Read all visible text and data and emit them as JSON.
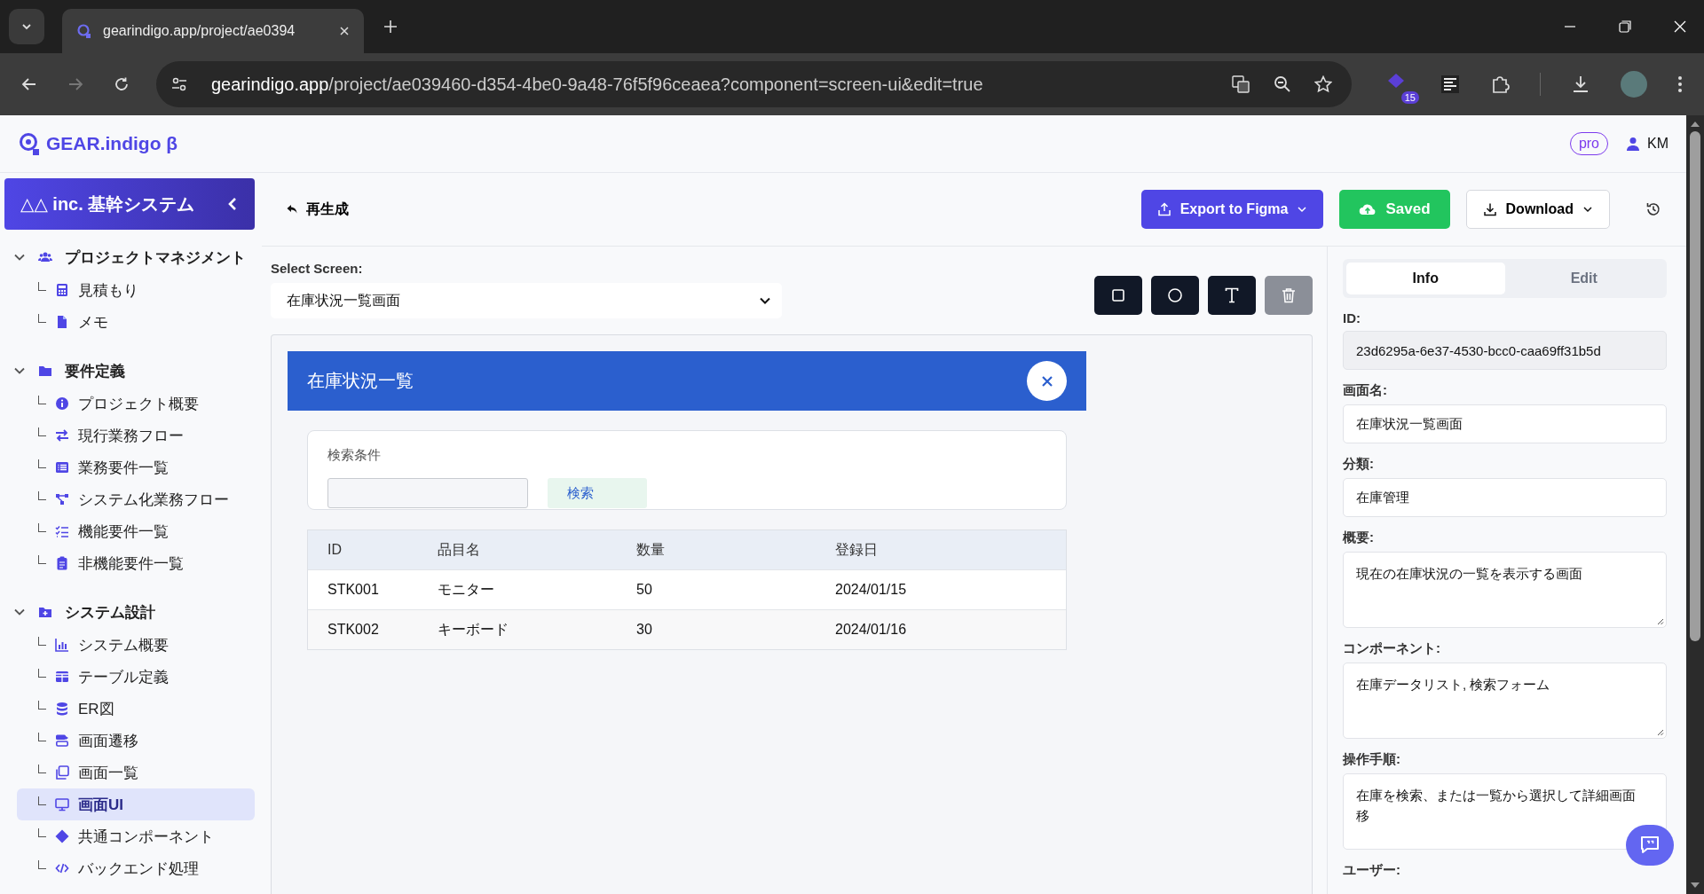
{
  "browser": {
    "tabs": [
      {
        "title": "gearindigo.app/project/ae0394",
        "selected": true
      }
    ],
    "url_host": "gearindigo.app",
    "url_path": "/project/ae039460-d354-4be0-9a48-76f5f96ceaea?component=screen-ui&edit=true",
    "extension_badge": "15"
  },
  "app": {
    "logo": "GEAR.indigo β",
    "plan_badge": "pro",
    "user": "KM"
  },
  "sidebar": {
    "project": "△△ inc. 基幹システム",
    "sections": [
      {
        "label": "プロジェクトマネジメント",
        "expanded": true,
        "children": [
          {
            "label": "見積もり",
            "selected": false
          },
          {
            "label": "メモ",
            "selected": false
          }
        ]
      },
      {
        "label": "要件定義",
        "expanded": true,
        "children": [
          {
            "label": "プロジェクト概要",
            "selected": false
          },
          {
            "label": "現行業務フロー",
            "selected": false
          },
          {
            "label": "業務要件一覧",
            "selected": false
          },
          {
            "label": "システム化業務フロー",
            "selected": false
          },
          {
            "label": "機能要件一覧",
            "selected": false
          },
          {
            "label": "非機能要件一覧",
            "selected": false
          }
        ]
      },
      {
        "label": "システム設計",
        "expanded": true,
        "children": [
          {
            "label": "システム概要",
            "selected": false
          },
          {
            "label": "テーブル定義",
            "selected": false
          },
          {
            "label": "ER図",
            "selected": false
          },
          {
            "label": "画面遷移",
            "selected": false
          },
          {
            "label": "画面一覧",
            "selected": false
          },
          {
            "label": "画面UI",
            "selected": true
          },
          {
            "label": "共通コンポーネント",
            "selected": false
          },
          {
            "label": "バックエンド処理",
            "selected": false
          }
        ]
      }
    ]
  },
  "toolbar": {
    "regenerate": "再生成",
    "export": "Export to Figma",
    "saved": "Saved",
    "download": "Download"
  },
  "screen_select": {
    "label": "Select Screen:",
    "value": "在庫状況一覧画面"
  },
  "preview": {
    "title": "在庫状況一覧",
    "search_label": "検索条件",
    "search_button": "検索",
    "table": {
      "columns": [
        "ID",
        "品目名",
        "数量",
        "登録日"
      ],
      "rows": [
        [
          "STK001",
          "モニター",
          "50",
          "2024/01/15"
        ],
        [
          "STK002",
          "キーボード",
          "30",
          "2024/01/16"
        ]
      ]
    }
  },
  "details": {
    "tabs": [
      {
        "label": "Info",
        "selected": true
      },
      {
        "label": "Edit",
        "selected": false
      }
    ],
    "fields": [
      {
        "kind": "readonly",
        "label": "ID:",
        "value": "23d6295a-6e37-4530-bcc0-caa69ff31b5d"
      },
      {
        "kind": "input",
        "label": "画面名:",
        "value": "在庫状況一覧画面"
      },
      {
        "kind": "input",
        "label": "分類:",
        "value": "在庫管理"
      },
      {
        "kind": "textarea",
        "label": "概要:",
        "value": "現在の在庫状況の一覧を表示する画面"
      },
      {
        "kind": "textarea",
        "label": "コンポーネント:",
        "value": "在庫データリスト, 検索フォーム"
      },
      {
        "kind": "textarea",
        "label": "操作手順:",
        "lines": [
          "在庫を検索、または一覧から選択して詳細画面",
          "移"
        ]
      },
      {
        "kind": "label",
        "label": "ユーザー:"
      }
    ]
  }
}
